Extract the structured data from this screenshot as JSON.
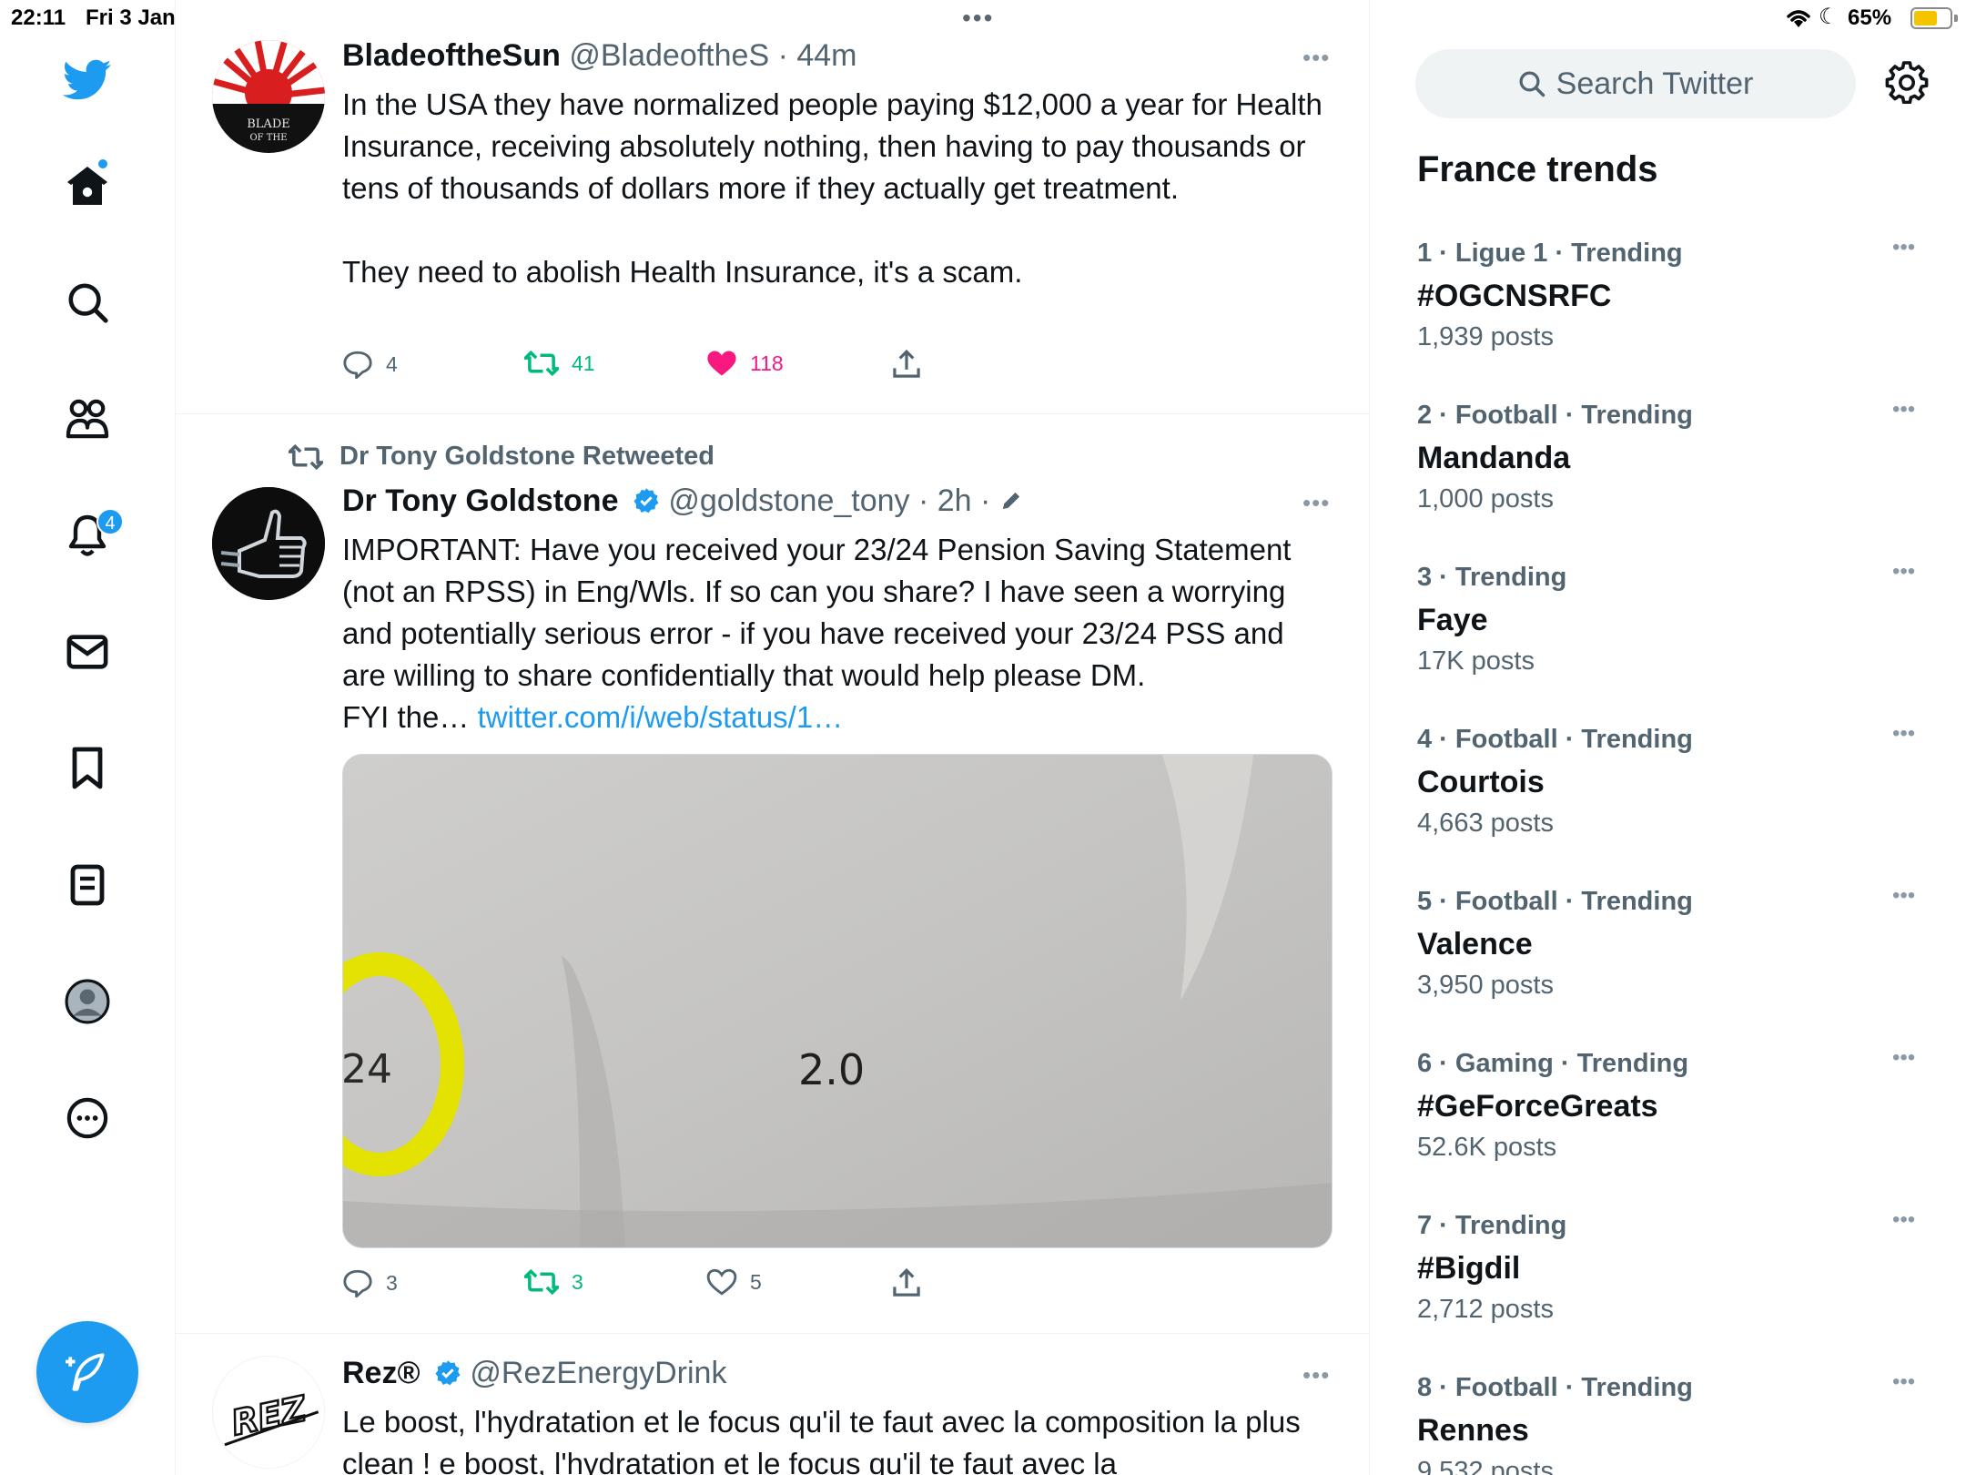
{
  "status_bar": {
    "time": "22:11",
    "date": "Fri 3 Jan",
    "battery": "65%",
    "battery_level": 0.65
  },
  "nav": {
    "notifications_badge": "4",
    "items": [
      "twitter-logo",
      "home-icon",
      "search-icon",
      "communities-icon",
      "notifications-icon",
      "messages-icon",
      "bookmarks-icon",
      "lists-icon",
      "profile-icon",
      "more-icon"
    ]
  },
  "feed": {
    "tweet1": {
      "name": "BladeoftheSun",
      "meta": " @BladeoftheS · 44m",
      "text": "In the USA they have normalized people paying $12,000 a year for Health Insurance, receiving absolutely nothing, then having to pay thousands or tens of thousands of dollars more if they actually get treatment.\n\nThey need to abolish Health Insurance, it's a scam.",
      "avatar_text": "BLADE OF THE SUN",
      "replies": "4",
      "retweets": "41",
      "likes": "118"
    },
    "tweet2": {
      "retweet_by": "Dr Tony Goldstone Retweeted",
      "name": "Dr Tony Goldstone",
      "meta": " @goldstone_tony · 2h · ",
      "text": "IMPORTANT: Have you received your 23/24 Pension Saving Statement (not an RPSS) in Eng/Wls. If so can you share? I have seen a worrying and potentially serious error - if you have received your 23/24 PSS and are willing to share confidentially that would help please DM.\nFYI the… ",
      "link": "twitter.com/i/web/status/1…",
      "media_text_left": "24",
      "media_text_center": "2.0",
      "replies": "3",
      "retweets": "3",
      "likes": "5"
    },
    "tweet3": {
      "name": "Rez®",
      "meta": " @RezEnergyDrink",
      "text": "Le boost, l'hydratation et le focus qu'il te faut avec la composition la plus clean ! e boost, l'hydratation et le focus qu'il te faut avec la",
      "avatar_text": "REZ"
    }
  },
  "sidebar": {
    "search_placeholder": "Search Twitter",
    "trends_title": "France trends",
    "trends": [
      {
        "context": "1 · Ligue 1 · Trending",
        "title": "#OGCNSRFC",
        "count": "1,939 posts"
      },
      {
        "context": "2 · Football · Trending",
        "title": "Mandanda",
        "count": "1,000 posts"
      },
      {
        "context": "3 · Trending",
        "title": "Faye",
        "count": "17K posts"
      },
      {
        "context": "4 · Football · Trending",
        "title": "Courtois",
        "count": "4,663 posts"
      },
      {
        "context": "5 · Football · Trending",
        "title": "Valence",
        "count": "3,950 posts"
      },
      {
        "context": "6 · Gaming · Trending",
        "title": "#GeForceGreats",
        "count": "52.6K posts"
      },
      {
        "context": "7 · Trending",
        "title": "#Bigdil",
        "count": "2,712 posts"
      },
      {
        "context": "8 · Football · Trending",
        "title": "Rennes",
        "count": "9,532 posts"
      }
    ]
  },
  "colors": {
    "accent": "#1d9bf0",
    "retweet": "#00ba7c",
    "like": "#f91880",
    "secondary_text": "#536471"
  }
}
